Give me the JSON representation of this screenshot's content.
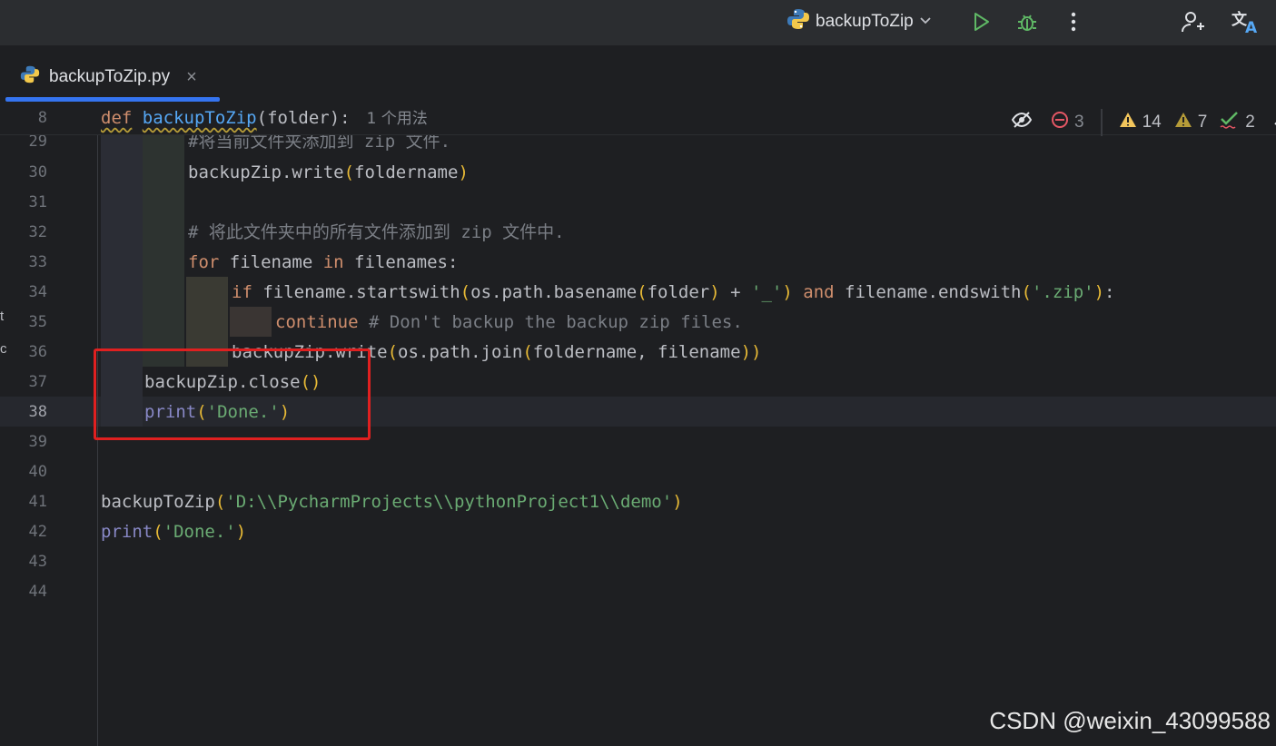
{
  "toolbar": {
    "run_config_label": "backupToZip"
  },
  "tab": {
    "label": "backupToZip.py",
    "close": "×"
  },
  "sticky": {
    "line_number": "8",
    "kw_def": "def",
    "fn_name": "backupToZip",
    "params": "(folder):",
    "usages": "1 个用法"
  },
  "inspections": {
    "errors": "3",
    "warnings": "14",
    "weak_warnings": "7",
    "typos": "2"
  },
  "lines": [
    {
      "n": "29",
      "text": "#将当前文件夹添加到 zip 文件."
    },
    {
      "n": "30",
      "text": "backupZip.write(foldername)"
    },
    {
      "n": "31",
      "text": ""
    },
    {
      "n": "32",
      "text": "# 将此文件夹中的所有文件添加到 zip 文件中."
    },
    {
      "n": "33",
      "text": "for filename in filenames:"
    },
    {
      "n": "34",
      "text": "if filename.startswith(os.path.basename(folder) + '_') and filename.endswith('.zip'):"
    },
    {
      "n": "35",
      "text": "continue # Don't backup the backup zip files."
    },
    {
      "n": "36",
      "text": "backupZip.write(os.path.join(foldername, filename))"
    },
    {
      "n": "37",
      "text": "backupZip.close()"
    },
    {
      "n": "38",
      "text": "print('Done.')"
    },
    {
      "n": "39",
      "text": ""
    },
    {
      "n": "40",
      "text": ""
    },
    {
      "n": "41",
      "text": "backupToZip('D:\\\\PycharmProjects\\\\pythonProject1\\\\demo')"
    },
    {
      "n": "42",
      "text": "print('Done.')"
    },
    {
      "n": "43",
      "text": ""
    },
    {
      "n": "44",
      "text": ""
    }
  ],
  "watermark": "CSDN @weixin_43099588",
  "side_fragments": [
    "t",
    "c"
  ],
  "colors": {
    "accent": "#3574f0",
    "run": "#5fb865",
    "error": "#e55765",
    "warning": "#f2c55c",
    "highlight_box": "#e02020"
  }
}
